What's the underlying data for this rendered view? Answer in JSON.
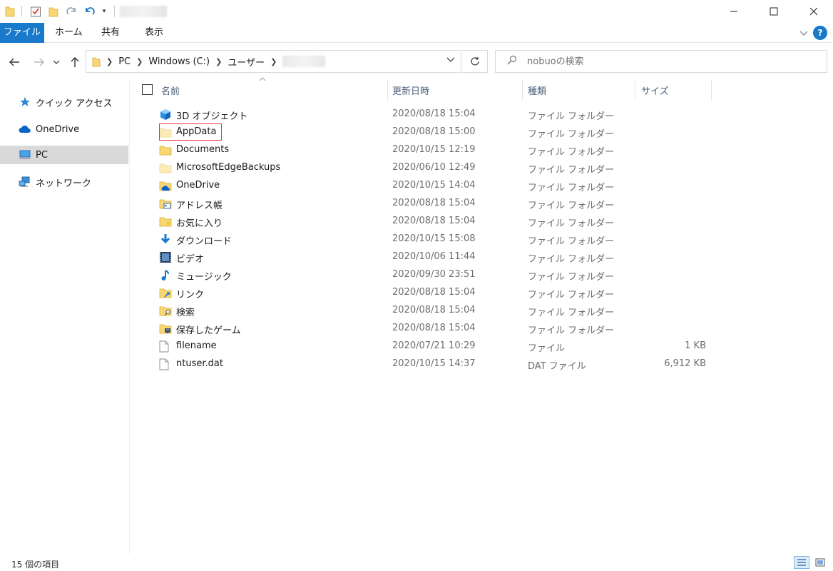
{
  "window": {
    "minimize_icon": "minimize-icon",
    "maximize_icon": "maximize-icon",
    "close_icon": "close-icon"
  },
  "ribbon": {
    "tabs": [
      "ファイル",
      "ホーム",
      "共有",
      "表示"
    ]
  },
  "address": {
    "crumbs": [
      "PC",
      "Windows (C:)",
      "ユーザー"
    ]
  },
  "search": {
    "placeholder": "nobuoの検索"
  },
  "navpane": {
    "items": [
      {
        "label": "クイック アクセス",
        "icon": "star-icon"
      },
      {
        "label": "OneDrive",
        "icon": "cloud-icon"
      },
      {
        "label": "PC",
        "icon": "computer-icon",
        "selected": true
      },
      {
        "label": "ネットワーク",
        "icon": "network-icon"
      }
    ]
  },
  "columns": {
    "name": "名前",
    "date": "更新日時",
    "type": "種類",
    "size": "サイズ"
  },
  "files": [
    {
      "name": "3D オブジェクト",
      "date": "2020/08/18 15:04",
      "type": "ファイル フォルダー",
      "size": "",
      "icon": "3d-objects-icon"
    },
    {
      "name": "AppData",
      "date": "2020/08/18 15:00",
      "type": "ファイル フォルダー",
      "size": "",
      "icon": "hidden-folder-icon",
      "highlighted": true
    },
    {
      "name": "Documents",
      "date": "2020/10/15 12:19",
      "type": "ファイル フォルダー",
      "size": "",
      "icon": "folder-icon"
    },
    {
      "name": "MicrosoftEdgeBackups",
      "date": "2020/06/10 12:49",
      "type": "ファイル フォルダー",
      "size": "",
      "icon": "hidden-folder-icon"
    },
    {
      "name": "OneDrive",
      "date": "2020/10/15 14:04",
      "type": "ファイル フォルダー",
      "size": "",
      "icon": "onedrive-folder-icon"
    },
    {
      "name": "アドレス帳",
      "date": "2020/08/18 15:04",
      "type": "ファイル フォルダー",
      "size": "",
      "icon": "contacts-folder-icon"
    },
    {
      "name": "お気に入り",
      "date": "2020/08/18 15:04",
      "type": "ファイル フォルダー",
      "size": "",
      "icon": "favorites-folder-icon"
    },
    {
      "name": "ダウンロード",
      "date": "2020/10/15 15:08",
      "type": "ファイル フォルダー",
      "size": "",
      "icon": "download-icon"
    },
    {
      "name": "ビデオ",
      "date": "2020/10/06 11:44",
      "type": "ファイル フォルダー",
      "size": "",
      "icon": "video-icon"
    },
    {
      "name": "ミュージック",
      "date": "2020/09/30 23:51",
      "type": "ファイル フォルダー",
      "size": "",
      "icon": "music-icon"
    },
    {
      "name": "リンク",
      "date": "2020/08/18 15:04",
      "type": "ファイル フォルダー",
      "size": "",
      "icon": "links-folder-icon"
    },
    {
      "name": "検索",
      "date": "2020/08/18 15:04",
      "type": "ファイル フォルダー",
      "size": "",
      "icon": "searches-folder-icon"
    },
    {
      "name": "保存したゲーム",
      "date": "2020/08/18 15:04",
      "type": "ファイル フォルダー",
      "size": "",
      "icon": "saved-games-icon"
    },
    {
      "name": "filename",
      "date": "2020/07/21 10:29",
      "type": "ファイル",
      "size": "1 KB",
      "icon": "file-icon"
    },
    {
      "name": "ntuser.dat",
      "date": "2020/10/15 14:37",
      "type": "DAT ファイル",
      "size": "6,912 KB",
      "icon": "file-icon"
    }
  ],
  "status": {
    "item_count": "15 個の項目"
  },
  "colors": {
    "accent": "#1979ca",
    "folder": "#f8d775",
    "highlight_box": "#e53935",
    "selected_nav": "#d9d9d9"
  }
}
